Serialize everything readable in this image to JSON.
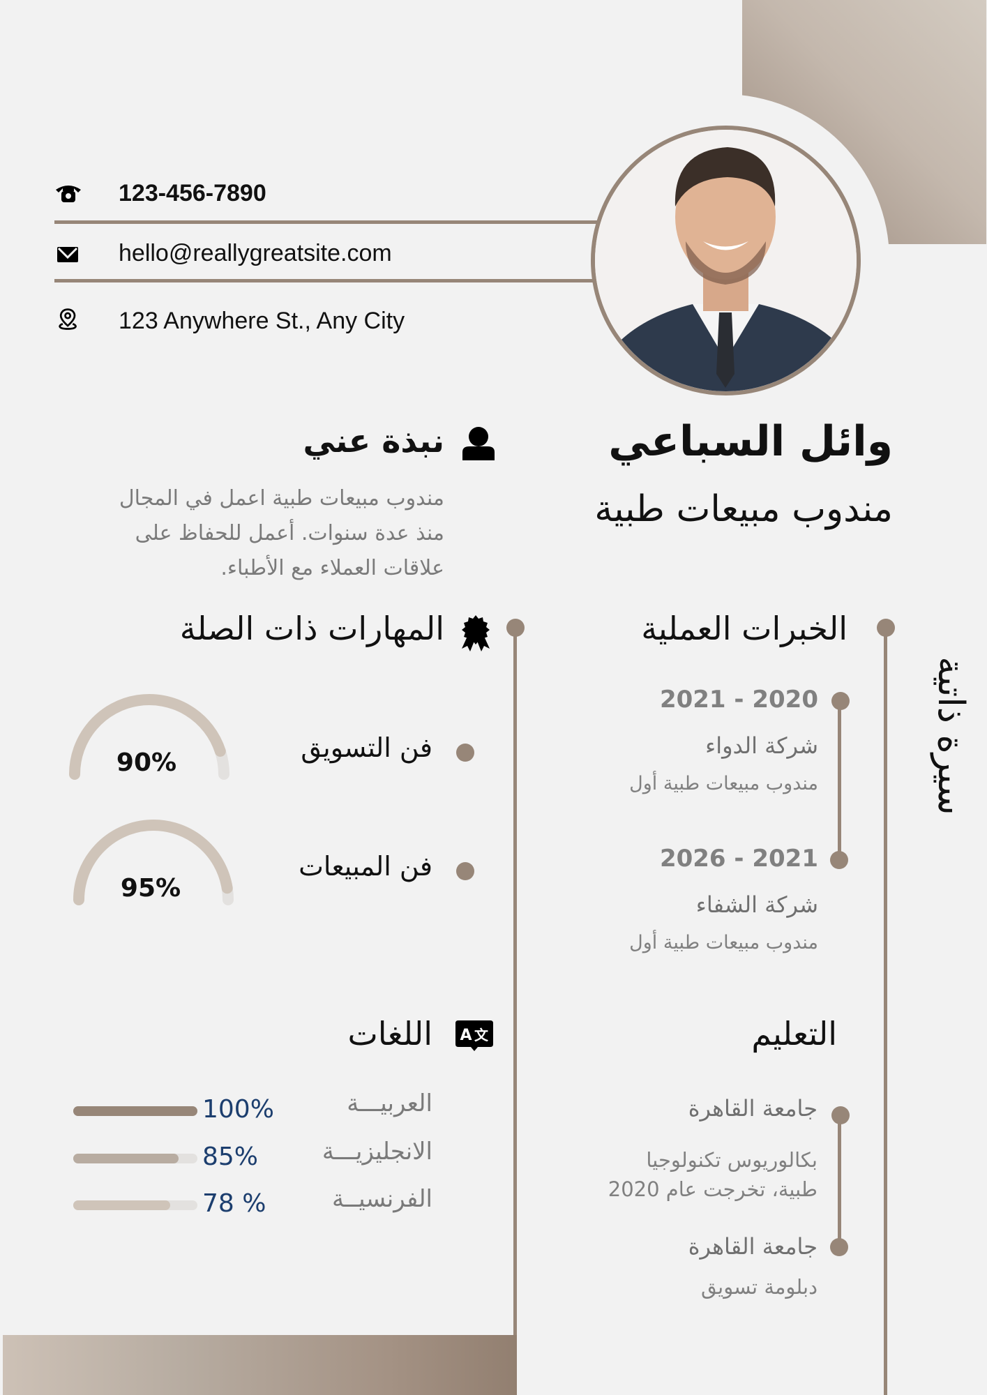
{
  "theme": {
    "accent": "#978678",
    "gauge_track": "#cfc4b9",
    "gauge_rest": "#e3e1df",
    "lang_colors": [
      "#978678",
      "#b8aca1",
      "#cfc4b9"
    ],
    "percent_text": "#1c3e6e"
  },
  "contact": {
    "phone": "123-456-7890",
    "email": "hello@reallygreatsite.com",
    "address": "123 Anywhere St., Any City"
  },
  "profile": {
    "name": "وائل السباعي",
    "title": "مندوب مبيعات طبية",
    "vertical_label": "سيرة ذاتية",
    "photo_alt": "صورة شخصية"
  },
  "about": {
    "heading": "نبذة عني",
    "lines": [
      "مندوب مبيعات طبية اعمل في المجال",
      "منذ عدة سنوات. أعمل  للحفاظ على",
      "علاقات العملاء مع الأطباء."
    ]
  },
  "experience": {
    "heading": "الخبرات العملية",
    "items": [
      {
        "period": "2021 - 2020",
        "company": "شركة الدواء",
        "role": "مندوب مبيعات طبية أول"
      },
      {
        "period": "2026 - 2021",
        "company": "شركة الشفاء",
        "role": "مندوب مبيعات طبية أول"
      }
    ]
  },
  "skills": {
    "heading": "المهارات ذات الصلة",
    "items": [
      {
        "name": "فن التسويق",
        "percent_label": "90%",
        "value": 0.9
      },
      {
        "name": "فن المبيعات",
        "percent_label": "95%",
        "value": 0.95
      }
    ]
  },
  "languages": {
    "heading": "اللغات",
    "items": [
      {
        "name": "العربيـــة",
        "percent_label": "100%",
        "value": 1.0
      },
      {
        "name": "الانجليزيـــة",
        "percent_label": "85%",
        "value": 0.85
      },
      {
        "name": "الفرنسيــة",
        "percent_label": "78 %",
        "value": 0.78
      }
    ]
  },
  "education": {
    "heading": "التعليم",
    "items": [
      {
        "school": "جامعة القاهرة",
        "lines": [
          "بكالوريوس تكنولوجيا",
          "طبية، تخرجت عام 2020"
        ]
      },
      {
        "school": "جامعة القاهرة",
        "lines": [
          "دبلومة تسويق"
        ]
      }
    ]
  }
}
